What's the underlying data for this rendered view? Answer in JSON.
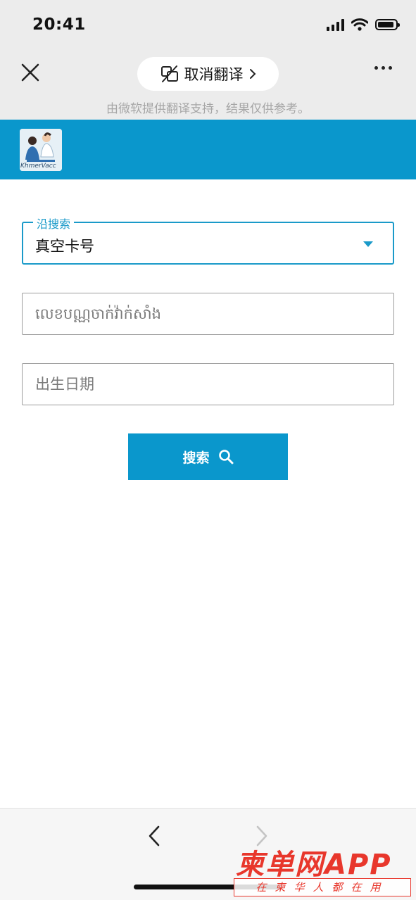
{
  "status_bar": {
    "time": "20:41"
  },
  "translation_bar": {
    "cancel_translation_label": "取消翻译",
    "translation_note": "由微软提供翻译支持，结果仅供参考。"
  },
  "header": {
    "logo_text": "KhmerVacc"
  },
  "form": {
    "search_by": {
      "legend": "沿搜索",
      "value": "真空卡号"
    },
    "card_number": {
      "placeholder": "លេខបណ្ណចាក់វ៉ាក់សាំង"
    },
    "date_of_birth": {
      "placeholder": "出生日期"
    },
    "search_button_label": "搜索"
  },
  "watermark": {
    "title": "柬单网APP",
    "subtitle": "在柬华人都在用"
  },
  "colors": {
    "brand": "#0a97cc",
    "field_accent": "#1a9ac9",
    "watermark": "#e8372c"
  }
}
